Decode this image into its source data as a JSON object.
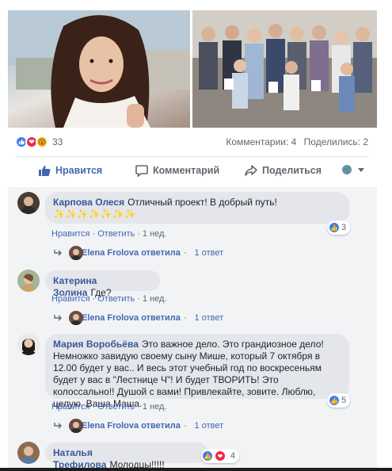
{
  "post": {
    "reactions_count": "33",
    "comments_count": "Комментарии: 4",
    "shares_count": "Поделились: 2"
  },
  "actions": {
    "like_label": "Нравится",
    "comment_label": "Комментарий",
    "share_label": "Поделиться"
  },
  "comments": [
    {
      "author": "Карпова Олеся",
      "text": "Отличный проект! В добрый путь!",
      "emoji": "✨✨✨✨✨✨✨",
      "like_label": "Нравится",
      "reply_label": "Ответить",
      "time": "1 нед.",
      "reaction_count": "3",
      "reply_author": "Elena Frolova ответила",
      "reply_count": "1 ответ"
    },
    {
      "author": "Катерина Золина",
      "text": "Где?",
      "like_label": "Нравится",
      "reply_label": "Ответить",
      "time": "1 нед.",
      "reply_author": "Elena Frolova ответила",
      "reply_count": "1 ответ"
    },
    {
      "author": "Мария Воробьёва",
      "text": "Это важное дело. Это грандиозное дело! Немножко завидую своему сыну Мише, который 7 октября в 12.00 будет у вас.. И весь этот учебный год по воскресеньям будет у вас в \"Лестнице Ч\"! И будет ТВОРИТЬ! Это колоссально!! Душой с вами! Привлекайте, зовите. Люблю, целую. Ваша Маша.",
      "like_label": "Нравится",
      "reply_label": "Ответить",
      "time": "1 нед.",
      "reaction_count": "5",
      "reply_author": "Elena Frolova ответила",
      "reply_count": "1 ответ"
    },
    {
      "author": "Наталья Трефилова",
      "text": "Молодцы!!!!!",
      "reaction_count": "4"
    }
  ],
  "colors": {
    "brand_blue": "#4267b2",
    "name_blue": "#385898",
    "like_blue": "#3b7cf5",
    "love_red": "#f0284a",
    "bubble_gray": "#e4e6eb"
  }
}
